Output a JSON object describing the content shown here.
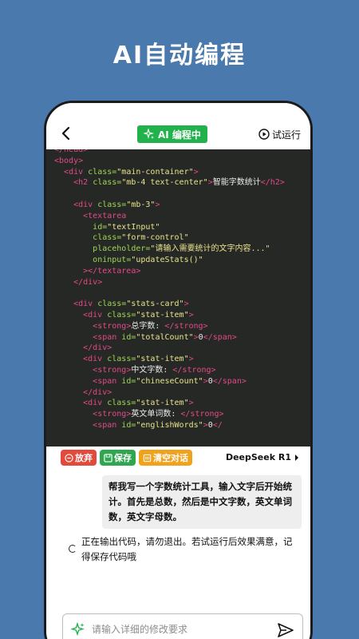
{
  "headline": "AI自动编程",
  "nav": {
    "badge_label": "AI 编程中",
    "run_label": "试运行"
  },
  "code": {
    "lines": [
      [
        [
          "tag",
          "</head>"
        ]
      ],
      [
        [
          "tag",
          "<body>"
        ]
      ],
      [
        [
          "txt",
          "  "
        ],
        [
          "tag",
          "<div "
        ],
        [
          "attr",
          "class="
        ],
        [
          "str",
          "\"main-container\""
        ],
        [
          "tag",
          ">"
        ]
      ],
      [
        [
          "txt",
          "    "
        ],
        [
          "tag",
          "<h2 "
        ],
        [
          "attr",
          "class="
        ],
        [
          "str",
          "\"mb-4 text-center\""
        ],
        [
          "tag",
          ">"
        ],
        [
          "txt",
          "智能字数统计"
        ],
        [
          "tag",
          "</h2>"
        ]
      ],
      [
        [
          "txt",
          ""
        ]
      ],
      [
        [
          "txt",
          "    "
        ],
        [
          "tag",
          "<div "
        ],
        [
          "attr",
          "class="
        ],
        [
          "str",
          "\"mb-3\""
        ],
        [
          "tag",
          ">"
        ]
      ],
      [
        [
          "txt",
          "      "
        ],
        [
          "tag",
          "<textarea"
        ]
      ],
      [
        [
          "txt",
          "        "
        ],
        [
          "attr",
          "id="
        ],
        [
          "str",
          "\"textInput\""
        ]
      ],
      [
        [
          "txt",
          "        "
        ],
        [
          "attr",
          "class="
        ],
        [
          "str",
          "\"form-control\""
        ]
      ],
      [
        [
          "txt",
          "        "
        ],
        [
          "attr",
          "placeholder="
        ],
        [
          "str",
          "\"请输入需要统计的文字内容...\""
        ]
      ],
      [
        [
          "txt",
          "        "
        ],
        [
          "attr",
          "oninput="
        ],
        [
          "str",
          "\"updateStats()\""
        ]
      ],
      [
        [
          "txt",
          "      "
        ],
        [
          "tag",
          "></textarea>"
        ]
      ],
      [
        [
          "txt",
          "    "
        ],
        [
          "tag",
          "</div>"
        ]
      ],
      [
        [
          "txt",
          ""
        ]
      ],
      [
        [
          "txt",
          "    "
        ],
        [
          "tag",
          "<div "
        ],
        [
          "attr",
          "class="
        ],
        [
          "str",
          "\"stats-card\""
        ],
        [
          "tag",
          ">"
        ]
      ],
      [
        [
          "txt",
          "      "
        ],
        [
          "tag",
          "<div "
        ],
        [
          "attr",
          "class="
        ],
        [
          "str",
          "\"stat-item\""
        ],
        [
          "tag",
          ">"
        ]
      ],
      [
        [
          "txt",
          "        "
        ],
        [
          "tag",
          "<strong>"
        ],
        [
          "txt",
          "总字数: "
        ],
        [
          "tag",
          "</strong>"
        ]
      ],
      [
        [
          "txt",
          "        "
        ],
        [
          "tag",
          "<span "
        ],
        [
          "attr",
          "id="
        ],
        [
          "str",
          "\"totalCount\""
        ],
        [
          "tag",
          ">"
        ],
        [
          "txt",
          "0"
        ],
        [
          "tag",
          "</span>"
        ]
      ],
      [
        [
          "txt",
          "      "
        ],
        [
          "tag",
          "</div>"
        ]
      ],
      [
        [
          "txt",
          "      "
        ],
        [
          "tag",
          "<div "
        ],
        [
          "attr",
          "class="
        ],
        [
          "str",
          "\"stat-item\""
        ],
        [
          "tag",
          ">"
        ]
      ],
      [
        [
          "txt",
          "        "
        ],
        [
          "tag",
          "<strong>"
        ],
        [
          "txt",
          "中文字数: "
        ],
        [
          "tag",
          "</strong>"
        ]
      ],
      [
        [
          "txt",
          "        "
        ],
        [
          "tag",
          "<span "
        ],
        [
          "attr",
          "id="
        ],
        [
          "str",
          "\"chineseCount\""
        ],
        [
          "tag",
          ">"
        ],
        [
          "txt",
          "0"
        ],
        [
          "tag",
          "</span>"
        ]
      ],
      [
        [
          "txt",
          "      "
        ],
        [
          "tag",
          "</div>"
        ]
      ],
      [
        [
          "txt",
          "      "
        ],
        [
          "tag",
          "<div "
        ],
        [
          "attr",
          "class="
        ],
        [
          "str",
          "\"stat-item\""
        ],
        [
          "tag",
          ">"
        ]
      ],
      [
        [
          "txt",
          "        "
        ],
        [
          "tag",
          "<strong>"
        ],
        [
          "txt",
          "英文单词数: "
        ],
        [
          "tag",
          "</strong>"
        ]
      ],
      [
        [
          "txt",
          "        "
        ],
        [
          "tag",
          "<span "
        ],
        [
          "attr",
          "id="
        ],
        [
          "str",
          "\"englishWords\""
        ],
        [
          "tag",
          ">"
        ],
        [
          "txt",
          "0"
        ],
        [
          "tag",
          "</"
        ]
      ]
    ]
  },
  "actions": {
    "discard_label": "放弃",
    "save_label": "保存",
    "clear_label": "清空对话"
  },
  "model_label": "DeepSeek R1",
  "user_message": "帮我写一个字数统计工具，输入文字后开始统计。首先是总数，然后是中文字数，英文单词数，英文字母数。",
  "status_message": "正在输出代码，请勿退出。若试运行后效果满意，记得保存代码哦",
  "input": {
    "placeholder": "请输入详细的修改要求"
  },
  "colors": {
    "background": "#4a79ad",
    "badge": "#22b24c",
    "code_bg": "#262826",
    "tag": "#e34a86",
    "attr": "#9fd654",
    "string": "#e8e38a",
    "discard": "#e24a3b",
    "save": "#2fa64f",
    "clear": "#f1a21d"
  },
  "icons": {
    "back": "chevron-left-icon",
    "sparkle": "sparkle-icon",
    "play": "play-circle-icon",
    "send": "send-icon"
  }
}
